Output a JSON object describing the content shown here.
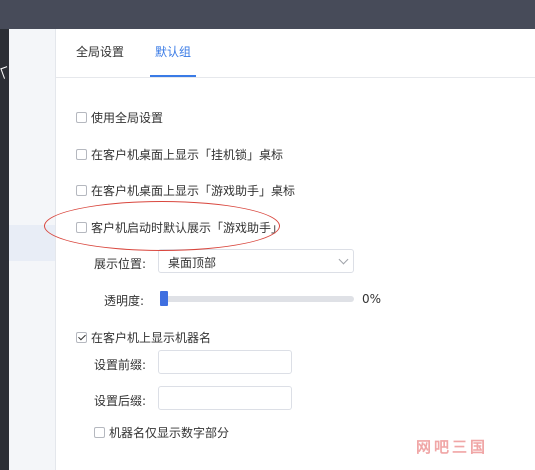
{
  "tabs": [
    "全局设置",
    "默认组"
  ],
  "options": {
    "use_global": "使用全局设置",
    "show_lock": "在客户机桌面上显示「挂机锁」桌标",
    "show_game_helper": "在客户机桌面上显示「游戏助手」桌标",
    "auto_show_game_helper": "客户机启动时默认展示「游戏助手」"
  },
  "display": {
    "position_label": "展示位置:",
    "position_value": "桌面顶部",
    "opacity_label": "透明度:",
    "opacity_value": "0%",
    "opacity_fraction": 0
  },
  "machine_name": {
    "show_label": "在客户机上显示机器名",
    "prefix_label": "设置前缀:",
    "prefix_value": "",
    "suffix_label": "设置后缀:",
    "suffix_value": "",
    "digits_only_label": "机器名仅显示数字部分"
  },
  "watermark": "网吧三国",
  "colors": {
    "accent": "#3a7be6",
    "highlight_ring": "#d9473e"
  }
}
